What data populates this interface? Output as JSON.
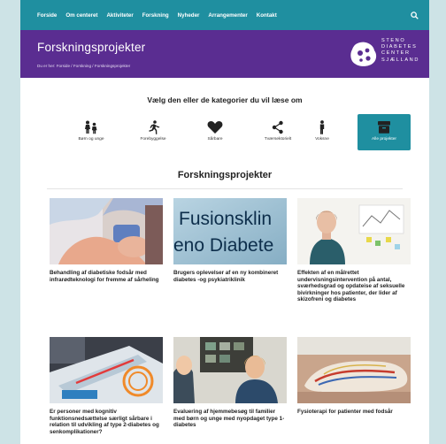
{
  "nav": {
    "items": [
      "Forside",
      "Om centeret",
      "Aktiviteter",
      "Forskning",
      "Nyheder",
      "Arrangementer",
      "Kontakt"
    ]
  },
  "header": {
    "title": "Forskningsprojekter",
    "breadcrumb": "Du er her: Forside / Forskning / Forskningsprojekter",
    "logo_lines": [
      "STENO",
      "DIABETES",
      "CENTER",
      "SJÆLLAND"
    ]
  },
  "categories": {
    "heading": "Vælg den eller de kategorier du vil læse om",
    "items": [
      {
        "label": "Børn og unge",
        "icon": "children-icon",
        "active": false
      },
      {
        "label": "Forebyggelse",
        "icon": "running-person-icon",
        "active": false
      },
      {
        "label": "Sårbare",
        "icon": "heart-icon",
        "active": false
      },
      {
        "label": "Tværsektorielt",
        "icon": "share-nodes-icon",
        "active": false
      },
      {
        "label": "Voksne",
        "icon": "adult-person-icon",
        "active": false
      },
      {
        "label": "Alle projekter",
        "icon": "archive-box-icon",
        "active": true
      }
    ]
  },
  "projects": {
    "heading": "Forskningsprojekter",
    "cards": [
      {
        "title": "Behandling af diabetiske fodsår med infrarødteknologi for fremme af sårheling"
      },
      {
        "title": "Brugers oplevelser af en ny kombineret diabetes -og psykiatriklinik"
      },
      {
        "title": "Effekten af en målrettet undervisningsintervention på antal, sværhedsgrad og opdateise af seksuelle bivirkninger hos patienter, der lider af skizofreni og diabetes"
      },
      {
        "title": "Er personer med kognitiv funktionsnedsættelse særligt sårbare i relation til udvikling af type 2-diabetes og senkomplikationer?"
      },
      {
        "title": "Evaluering af hjemmebesøg til familier med børn og unge med nyopdaget type 1-diabetes"
      },
      {
        "title": "Fysioterapi for patienter med fodsår"
      }
    ],
    "image_texts": [
      "Fusionsklin",
      "eno Diabete"
    ]
  }
}
